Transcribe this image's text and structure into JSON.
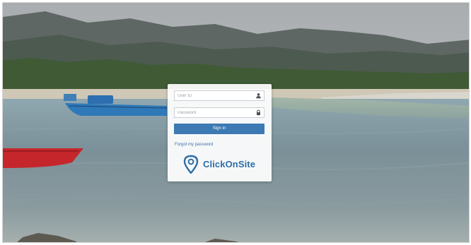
{
  "login": {
    "user_placeholder": "User ID",
    "password_placeholder": "Password",
    "signin_label": "Sign in",
    "forgot_label": "Forgot my password"
  },
  "brand": {
    "name": "ClickOnSite"
  },
  "icons": {
    "user_field": "user-icon",
    "password_field": "lock-icon",
    "logo": "map-pin-icon"
  },
  "colors": {
    "accent": "#3d79b2",
    "brand": "#2d6ea8"
  }
}
